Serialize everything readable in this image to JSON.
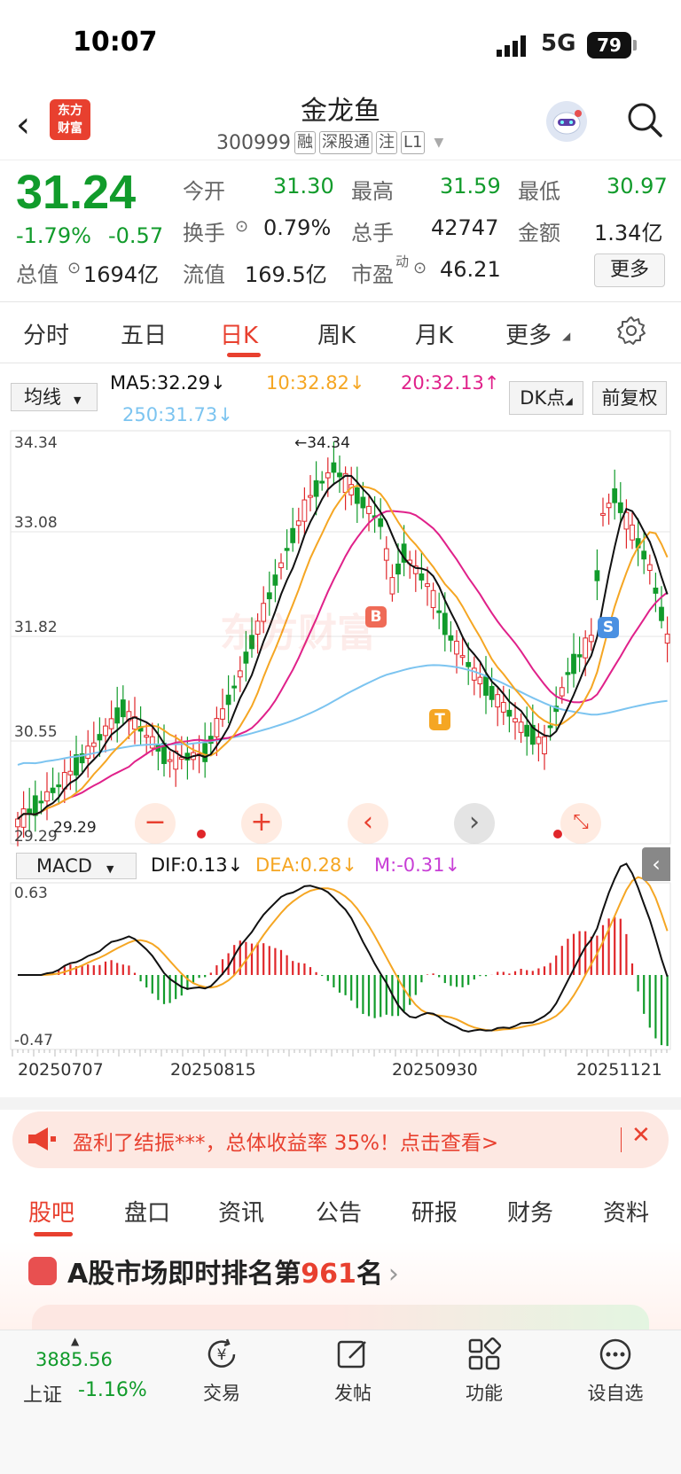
{
  "status": {
    "time": "10:07",
    "network": "5G",
    "battery": "79"
  },
  "header": {
    "logo_line1": "东方",
    "logo_line2": "财富",
    "name": "金龙鱼",
    "code": "300999",
    "tags": [
      "融",
      "深股通",
      "注",
      "L1"
    ]
  },
  "quote": {
    "price": "31.24",
    "change_pct": "-1.79%",
    "change": "-0.57",
    "open_label": "今开",
    "open": "31.30",
    "high_label": "最高",
    "high": "31.59",
    "low_label": "最低",
    "low": "30.97",
    "turnover_label": "换手",
    "turnover": "0.79%",
    "volume_label": "总手",
    "volume": "42747",
    "amount_label": "金额",
    "amount": "1.34亿",
    "mcap_label": "总值",
    "mcap": "1694亿",
    "float_label": "流值",
    "float": "169.5亿",
    "pe_label": "市盈",
    "pe_sup": "动",
    "pe": "46.21",
    "more": "更多"
  },
  "tabs": [
    "分时",
    "五日",
    "日K",
    "周K",
    "月K",
    "更多"
  ],
  "kline": {
    "ma_select": "均线",
    "ma5": "MA5:32.29↓",
    "ma10": "10:32.82↓",
    "ma20": "20:32.13↑",
    "ma250": "250:31.73↓",
    "dk_button": "DK点",
    "fq_button": "前复权",
    "y_labels": [
      "34.34",
      "33.08",
      "31.82",
      "30.55",
      "29.29"
    ],
    "max_marker": "←34.34",
    "min_marker": "29.29",
    "b_mark": "B",
    "t_mark": "T",
    "s_mark": "S",
    "watermark": "东方财富"
  },
  "macd": {
    "select": "MACD",
    "dif": "DIF:0.13↓",
    "dea": "DEA:0.28↓",
    "m": "M:-0.31↓",
    "y_top": "0.63",
    "y_bottom": "-0.47"
  },
  "dates": [
    "20250707",
    "20250815",
    "20250930",
    "20251121"
  ],
  "controls": {
    "zoom_out": "−",
    "zoom_in": "+",
    "prev": "‹",
    "next": "›"
  },
  "promo": {
    "text": "盈利了结振***，总体收益率 35%！点击查看>",
    "close": "✕"
  },
  "bottom_tabs": [
    "股吧",
    "盘口",
    "资讯",
    "公告",
    "研报",
    "财务",
    "资料"
  ],
  "rank": {
    "prefix": "A股市场即时排名第",
    "num": "961",
    "suffix": "名",
    "arrow": "›"
  },
  "bottom_nav": {
    "index_value": "3885.56",
    "index_name": "上证",
    "index_change": "-1.16%",
    "items": [
      "交易",
      "发帖",
      "功能",
      "设自选"
    ]
  },
  "colors": {
    "up": "#e0262a",
    "down": "#119b2b",
    "ma5": "#111111",
    "ma10": "#f5a623",
    "ma20": "#e0218a",
    "ma250": "#7cc4f0"
  }
}
